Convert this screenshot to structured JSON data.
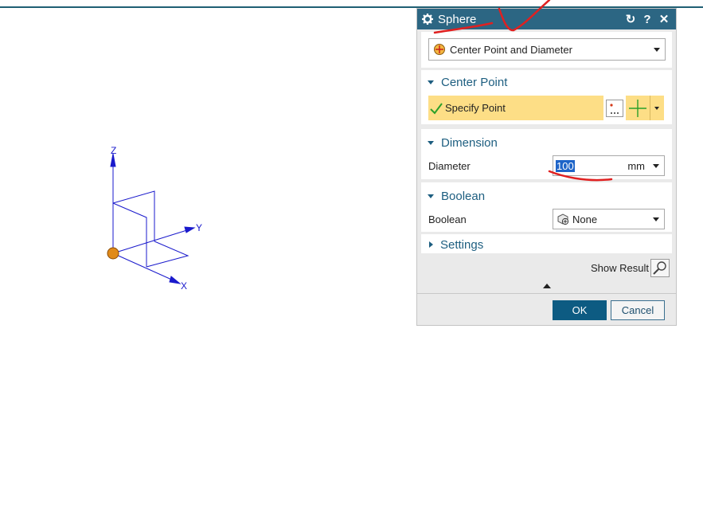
{
  "dialog": {
    "title": "Sphere",
    "type_select": {
      "value": "Center Point and Diameter"
    },
    "center_point": {
      "header": "Center Point",
      "specify_label": "Specify Point"
    },
    "dimension": {
      "header": "Dimension",
      "diameter_label": "Diameter",
      "diameter_value": "100",
      "unit": "mm"
    },
    "boolean": {
      "header": "Boolean",
      "label": "Boolean",
      "value": "None"
    },
    "settings": {
      "header": "Settings"
    },
    "show_result_label": "Show Result",
    "ok_label": "OK",
    "cancel_label": "Cancel"
  },
  "csys": {
    "z_label": "Z",
    "y_label": "Y",
    "x_label": "X"
  },
  "colors": {
    "title_bar": "#2c6683",
    "accent": "#1d5e80",
    "highlight": "#fdde86",
    "annotation": "#e02020",
    "axis": "#1a1acc"
  }
}
